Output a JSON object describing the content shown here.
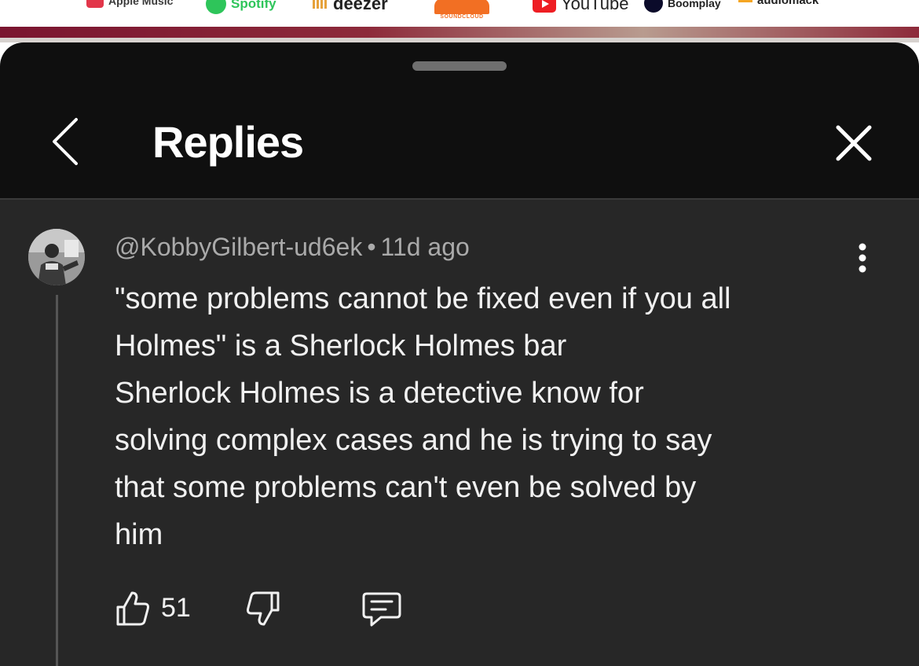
{
  "banner": {
    "logos": [
      {
        "name": "apple-music-logo",
        "text": "Apple Music"
      },
      {
        "name": "spotify-logo",
        "text": "Spotify"
      },
      {
        "name": "deezer-logo",
        "text": "deezer"
      },
      {
        "name": "soundcloud-logo",
        "text": "SOUNDCLOUD"
      },
      {
        "name": "youtube-logo",
        "text": "YouTube"
      },
      {
        "name": "boomplay-logo",
        "text": "Boomplay"
      },
      {
        "name": "audiomack-logo",
        "text": "audiomack"
      }
    ]
  },
  "sheet": {
    "title": "Replies",
    "back_icon": "chevron-left-icon",
    "close_icon": "close-icon"
  },
  "comment": {
    "author": "@KobbyGilbert-ud6ek",
    "separator": "•",
    "time": "11d ago",
    "lines": [
      "\"some problems cannot be fixed even if you all",
      "Holmes\" is a Sherlock Holmes bar",
      "Sherlock Holmes is a detective know for",
      "solving complex cases and he is trying to say",
      "that some problems can't even be solved by",
      "him"
    ],
    "like_count": "51",
    "actions": [
      "thumbs-up-icon",
      "thumbs-down-icon",
      "reply-icon"
    ],
    "menu_icon": "more-vertical-icon"
  },
  "colors": {
    "sheet_bg": "#0f0f0f",
    "comment_bg": "#272727",
    "primary_text": "#f1f1f1",
    "secondary_text": "#aaaaaa",
    "banner_strip": "#7a1530"
  }
}
